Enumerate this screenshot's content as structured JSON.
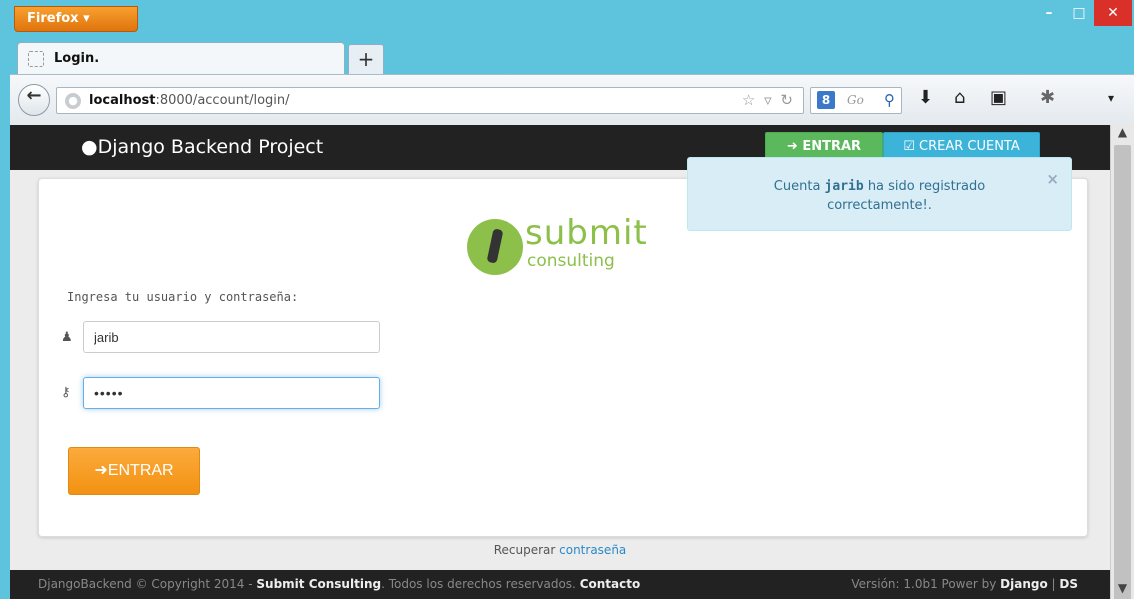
{
  "browser": {
    "menu_label": "Firefox ▾",
    "tab_title": "Login.",
    "new_tab_glyph": "+",
    "url_host": "localhost",
    "url_path": ":8000/account/login/",
    "search_placeholder": "Go",
    "search_engine_glyph": "8",
    "window_controls": {
      "minimize": "–",
      "maximize": "□",
      "close": "✕"
    }
  },
  "topnav": {
    "brand": "Django Backend Project",
    "enter_label": "ENTRAR",
    "create_label": "CREAR CUENTA"
  },
  "logo": {
    "word": "submit",
    "sub": "consulting"
  },
  "login": {
    "prompt": "Ingresa tu usuario y contraseña:",
    "username_value": "jarib",
    "password_value": "•••••",
    "submit_label": "ENTRAR"
  },
  "alert": {
    "prefix": "Cuenta ",
    "username": "jarib",
    "message_rest": " ha sido registrado",
    "line2": "correctamente!.",
    "close_glyph": "×"
  },
  "recover": {
    "prefix": "Recuperar ",
    "link": "contraseña"
  },
  "footer": {
    "left_prefix": "DjangoBackend © Copyright 2014 - ",
    "company": "Submit Consulting",
    "rights": ". Todos los derechos reservados. ",
    "contact": "Contacto",
    "version": "Versión: 1.0b1 Power by ",
    "django": "Django",
    "sep": " | ",
    "ds": "DS"
  },
  "colors": {
    "navbar": "#222222",
    "success": "#5cb85c",
    "info": "#3cb4d9",
    "warning": "#f39212",
    "alert_bg": "#d9edf7",
    "brand_green": "#8dc04a"
  }
}
